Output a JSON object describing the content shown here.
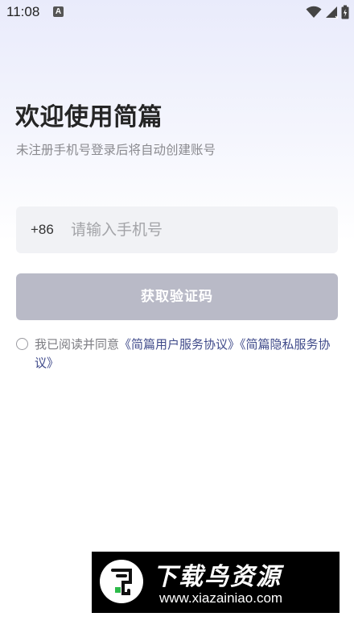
{
  "status_bar": {
    "time": "11:08",
    "notification_icon": "A"
  },
  "header": {
    "title": "欢迎使用简篇",
    "subtitle": "未注册手机号登录后将自动创建账号"
  },
  "phone": {
    "country_code": "+86",
    "placeholder": "请输入手机号",
    "value": ""
  },
  "get_code_button": {
    "label": "获取验证码"
  },
  "agreement": {
    "checked": false,
    "prefix": "我已阅读并同意",
    "user_agreement": "《简篇用户服务协议》",
    "privacy_agreement": "《简篇隐私服务协议》"
  },
  "watermark": {
    "name": "下载鸟资源",
    "url": "www.xiazainiao.com"
  },
  "colors": {
    "button_disabled": "#b9bac7",
    "link": "#3f4a8a",
    "input_bg": "#f1f2f5"
  },
  "icons": [
    "wifi-icon",
    "signal-icon",
    "battery-icon",
    "radio-unchecked-icon"
  ]
}
